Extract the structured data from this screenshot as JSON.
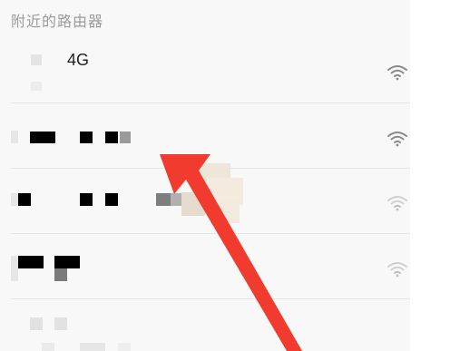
{
  "section": {
    "title": "附近的路由器"
  },
  "networks": [
    {
      "name": "4G",
      "signal": "strong",
      "icon": "wifi-icon"
    },
    {
      "name": "",
      "signal": "strong",
      "icon": "wifi-icon"
    },
    {
      "name": "",
      "signal": "weak",
      "icon": "wifi-icon"
    },
    {
      "name": "",
      "signal": "weak",
      "icon": "wifi-icon"
    },
    {
      "name": "",
      "signal": "unknown",
      "icon": ""
    }
  ],
  "colors": {
    "arrow": "#f23b2f",
    "wifi_strong": "#8a8a8a",
    "wifi_weak": "#c8c8c8",
    "header_text": "#9a9a9a"
  }
}
